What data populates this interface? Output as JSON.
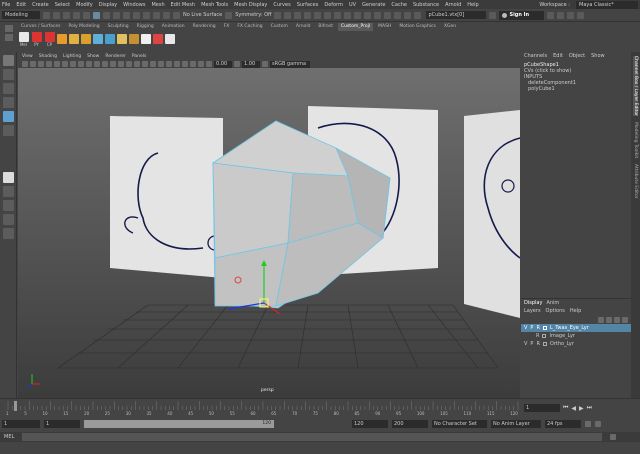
{
  "menubar": {
    "items": [
      "File",
      "Edit",
      "Create",
      "Select",
      "Modify",
      "Display",
      "Windows",
      "Mesh",
      "Edit Mesh",
      "Mesh Tools",
      "Mesh Display",
      "Curves",
      "Surfaces",
      "Deform",
      "UV",
      "Generate",
      "Cache",
      "Substance",
      "Arnold",
      "Help"
    ],
    "workspace_label": "Workspace :",
    "workspace_value": "Maya Classic*"
  },
  "statusline": {
    "mode": "Modeling",
    "live_surface": "No Live Surface",
    "symmetry": "Symmetry: Off",
    "object_name": "pCube1.vtx[0]",
    "sign_in": "Sign In"
  },
  "shelf": {
    "tabs": [
      "Curves / Surfaces",
      "Poly Modeling",
      "Sculpting",
      "Rigging",
      "Animation",
      "Rendering",
      "FX",
      "FX Caching",
      "Custom",
      "Arnold",
      "Bifrost",
      "Custom_Projl",
      "MASH",
      "Motion Graphics",
      "XGen"
    ],
    "active_tab": 11,
    "icon_labels": [
      "Mel",
      "PY",
      "CP"
    ]
  },
  "panel": {
    "menu": [
      "View",
      "Shading",
      "Lighting",
      "Show",
      "Renderer",
      "Panels"
    ],
    "exposure": "0.00",
    "gamma": "1.00",
    "color_space": "sRGB gamma",
    "camera_label": "persp"
  },
  "channel_box": {
    "menu": [
      "Channels",
      "Edit",
      "Object",
      "Show"
    ],
    "shape_name": "pCubeShape1",
    "cvs_label": "CVs (click to show)",
    "inputs_label": "INPUTS",
    "inputs": [
      "deleteComponent1",
      "polyCube1"
    ]
  },
  "layer_editor": {
    "tabs": [
      "Display",
      "Anim"
    ],
    "menu": [
      "Layers",
      "Options",
      "Help"
    ],
    "layers": [
      {
        "v": "V",
        "p": "P",
        "r": "R",
        "name": "L_Twas_Eye_Lyr",
        "selected": true
      },
      {
        "v": "",
        "p": "",
        "r": "R",
        "name": "Image_Lyr",
        "selected": false
      },
      {
        "v": "V",
        "p": "P",
        "r": "R",
        "name": "Ortho_Lyr",
        "selected": false
      }
    ]
  },
  "side_tabs": [
    "Channel Box / Layer Editor",
    "Modeling Toolkit",
    "Attribute Editor"
  ],
  "timeline": {
    "ticks": [
      "1",
      "5",
      "10",
      "15",
      "20",
      "25",
      "30",
      "35",
      "40",
      "45",
      "50",
      "55",
      "60",
      "65",
      "70",
      "75",
      "80",
      "85",
      "90",
      "95",
      "100",
      "105",
      "110",
      "115",
      "120"
    ],
    "current_frame": "1"
  },
  "range": {
    "start": "1",
    "current": "1",
    "range_mid": "120",
    "range_end": "120",
    "end": "200",
    "character_set": "No Character Set",
    "anim_layer": "No Anim Layer",
    "fps": "24 fps"
  },
  "cmdline": {
    "label": "MEL"
  },
  "colors": {
    "accent": "#5285a6",
    "selected_layer": "#5285a6",
    "mesh_edge": "#6ec6e6",
    "bg": "#444444"
  }
}
